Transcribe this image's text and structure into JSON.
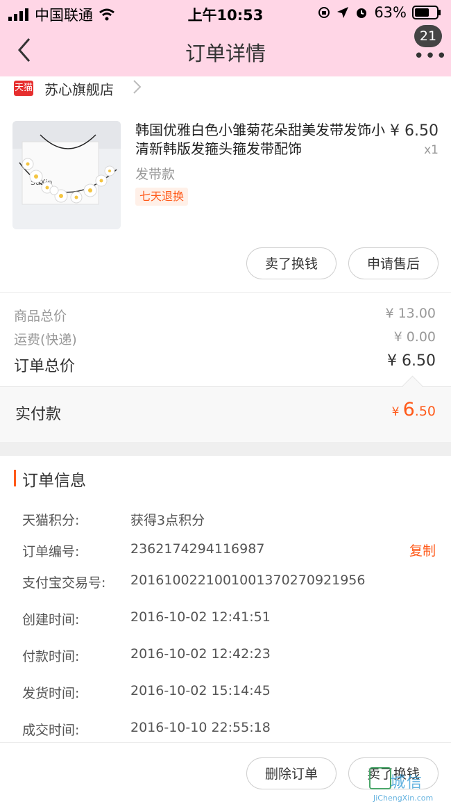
{
  "status_bar": {
    "carrier": "中国联通",
    "time": "上午10:53",
    "battery": "63%"
  },
  "nav": {
    "title": "订单详情",
    "badge_count": "21",
    "more": "•••"
  },
  "store": {
    "logo_text": "天猫",
    "name": "苏心旗舰店"
  },
  "product": {
    "title": "韩国优雅白色小雏菊花朵甜美发带发饰小清新韩版发箍头箍发带配饰",
    "sku": "发带款",
    "tag": "七天退换",
    "price": "¥ 6.50",
    "qty": "x1",
    "image_text": "SuXin"
  },
  "item_actions": {
    "sell_label": "卖了换钱",
    "aftersale_label": "申请售后"
  },
  "summary": {
    "goods_total_label": "商品总价",
    "goods_total_value": "¥ 13.00",
    "shipping_label": "运费(快递)",
    "shipping_value": "¥ 0.00",
    "order_total_label": "订单总价",
    "order_total_value": "¥ 6.50"
  },
  "paid": {
    "label": "实付款",
    "currency": "¥",
    "integer": "6",
    "decimal": ".50"
  },
  "order_info": {
    "title": "订单信息",
    "copy_label": "复制",
    "rows": [
      {
        "label": "天猫积分:",
        "value": "获得3点积分"
      },
      {
        "label": "订单编号:",
        "value": "2362174294116987"
      },
      {
        "label": "支付宝交易号:",
        "value": "2016100221001001370270921956"
      },
      {
        "label": "创建时间:",
        "value": "2016-10-02 12:41:51"
      },
      {
        "label": "付款时间:",
        "value": "2016-10-02 12:42:23"
      },
      {
        "label": "发货时间:",
        "value": "2016-10-02 15:14:45"
      },
      {
        "label": "成交时间:",
        "value": "2016-10-10 22:55:18"
      }
    ]
  },
  "bottom_actions": {
    "delete_label": "删除订单",
    "sell_label": "卖了换钱"
  },
  "watermark": {
    "text": "城信",
    "sub": "JiChengXin.com"
  },
  "colors": {
    "header_bg": "#ffd6e6",
    "accent": "#ff5a1a",
    "tmall_red": "#e62e2e"
  }
}
